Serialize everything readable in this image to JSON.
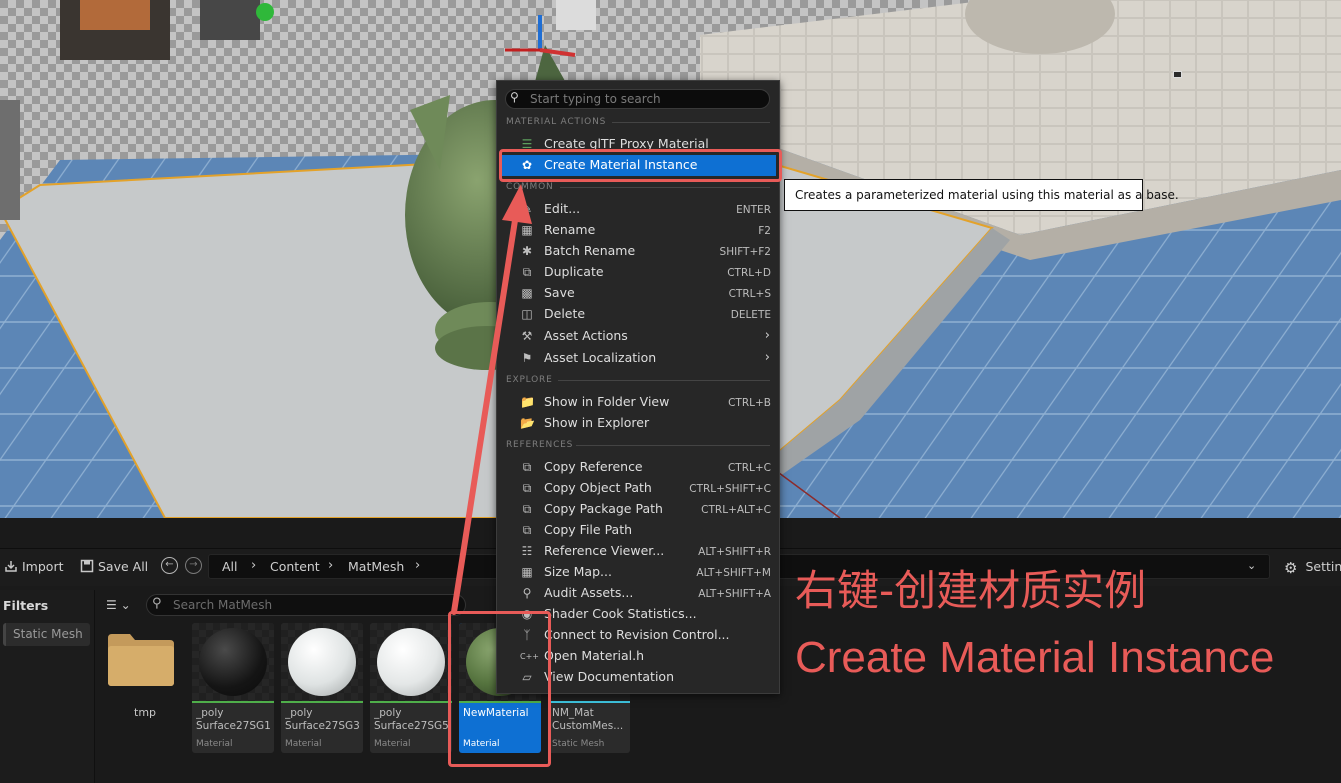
{
  "toolbar": {
    "import_label": "Import",
    "save_all_label": "Save All",
    "settings_label": "Settings",
    "breadcrumbs": [
      "All",
      "Content",
      "MatMesh"
    ]
  },
  "filters": {
    "label": "Filters",
    "chip_label": "Static Mesh",
    "search_placeholder": "Search MatMesh"
  },
  "assets": {
    "folder": {
      "label": "tmp",
      "icon": "folder-icon"
    },
    "tiles": [
      {
        "name": "_poly\nSurface27SG1",
        "type": "Material",
        "sphere": "#1f1f1f"
      },
      {
        "name": "_poly\nSurface27SG3",
        "type": "Material",
        "sphere": "#e9ecec"
      },
      {
        "name": "_poly\nSurface27SG5",
        "type": "Material",
        "sphere": "#eef0f0"
      },
      {
        "name": "NewMaterial",
        "type": "Material",
        "sphere": "#5f7f4e",
        "selected": true
      },
      {
        "name": "NM_Mat\nCustomMes...",
        "type": "Static Mesh"
      }
    ]
  },
  "context_menu": {
    "search_placeholder": "Start typing to search",
    "sections": {
      "material_actions": "MATERIAL ACTIONS",
      "common": "COMMON",
      "explore": "EXPLORE",
      "references": "REFERENCES"
    },
    "material_actions": [
      {
        "label": "Create glTF Proxy Material",
        "icon": "gltf-icon"
      },
      {
        "label": "Create Material Instance",
        "icon": "material-instance-icon",
        "highlighted": true
      }
    ],
    "common": [
      {
        "label": "Edit...",
        "shortcut": "ENTER",
        "icon": "pencil-icon"
      },
      {
        "label": "Rename",
        "shortcut": "F2",
        "icon": "rename-icon"
      },
      {
        "label": "Batch Rename",
        "shortcut": "SHIFT+F2",
        "icon": "batch-rename-icon"
      },
      {
        "label": "Duplicate",
        "shortcut": "CTRL+D",
        "icon": "duplicate-icon"
      },
      {
        "label": "Save",
        "shortcut": "CTRL+S",
        "icon": "save-icon"
      },
      {
        "label": "Delete",
        "shortcut": "DELETE",
        "icon": "trash-icon"
      },
      {
        "label": "Asset Actions",
        "submenu": true,
        "icon": "wrench-icon"
      },
      {
        "label": "Asset Localization",
        "submenu": true,
        "icon": "flag-icon"
      }
    ],
    "explore": [
      {
        "label": "Show in Folder View",
        "shortcut": "CTRL+B",
        "icon": "folder-search-icon"
      },
      {
        "label": "Show in Explorer",
        "icon": "explorer-icon"
      }
    ],
    "references": [
      {
        "label": "Copy Reference",
        "shortcut": "CTRL+C",
        "icon": "copy-icon"
      },
      {
        "label": "Copy Object Path",
        "shortcut": "CTRL+SHIFT+C",
        "icon": "copy-icon"
      },
      {
        "label": "Copy Package Path",
        "shortcut": "CTRL+ALT+C",
        "icon": "copy-icon"
      },
      {
        "label": "Copy File Path",
        "icon": "copy-icon"
      },
      {
        "label": "Reference Viewer...",
        "shortcut": "ALT+SHIFT+R",
        "icon": "reference-viewer-icon"
      },
      {
        "label": "Size Map...",
        "shortcut": "ALT+SHIFT+M",
        "icon": "size-map-icon"
      },
      {
        "label": "Audit Assets...",
        "shortcut": "ALT+SHIFT+A",
        "icon": "audit-icon"
      },
      {
        "label": "Shader Cook Statistics...",
        "icon": "shader-icon"
      },
      {
        "label": "Connect to Revision Control...",
        "icon": "revision-control-icon"
      },
      {
        "label": "Open Material.h",
        "icon": "cpp-icon"
      },
      {
        "label": "View Documentation",
        "icon": "documentation-icon"
      }
    ]
  },
  "tooltip": "Creates a parameterized material using this material as a base.",
  "annotation": {
    "chinese": "右键-创建材质实例",
    "english": "Create Material Instance",
    "color": "#e85b58"
  }
}
